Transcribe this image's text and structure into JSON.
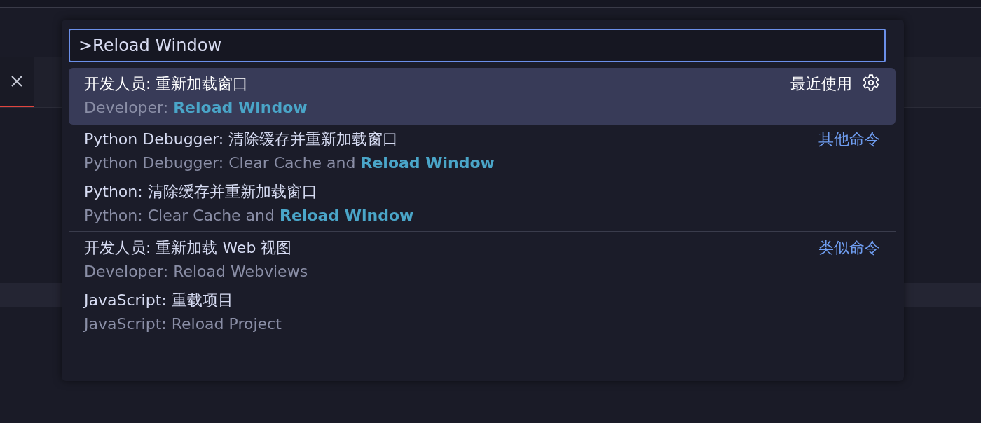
{
  "quick_input": {
    "value": ">Reload Window",
    "items": [
      {
        "label": "开发人员: 重新加载窗口",
        "detail": "Developer: **Reload Window**",
        "group": "最近使用",
        "selected": true,
        "separator": false
      },
      {
        "label": "Python Debugger: 清除缓存并重新加载窗口",
        "detail": "Python Debugger: Clear Cache and **Reload Window**",
        "group": "其他命令",
        "selected": false,
        "separator": false
      },
      {
        "label": "Python: 清除缓存并重新加载窗口",
        "detail": "Python: Clear Cache and **Reload Window**",
        "selected": false,
        "separator": false
      },
      {
        "label": "开发人员: 重新加载 Web 视图",
        "detail": "Developer: Reload Webviews",
        "group": "类似命令",
        "selected": false,
        "separator": true
      },
      {
        "label": "JavaScript: 重载项目",
        "detail": "JavaScript: Reload Project",
        "selected": false,
        "separator": false
      }
    ]
  }
}
